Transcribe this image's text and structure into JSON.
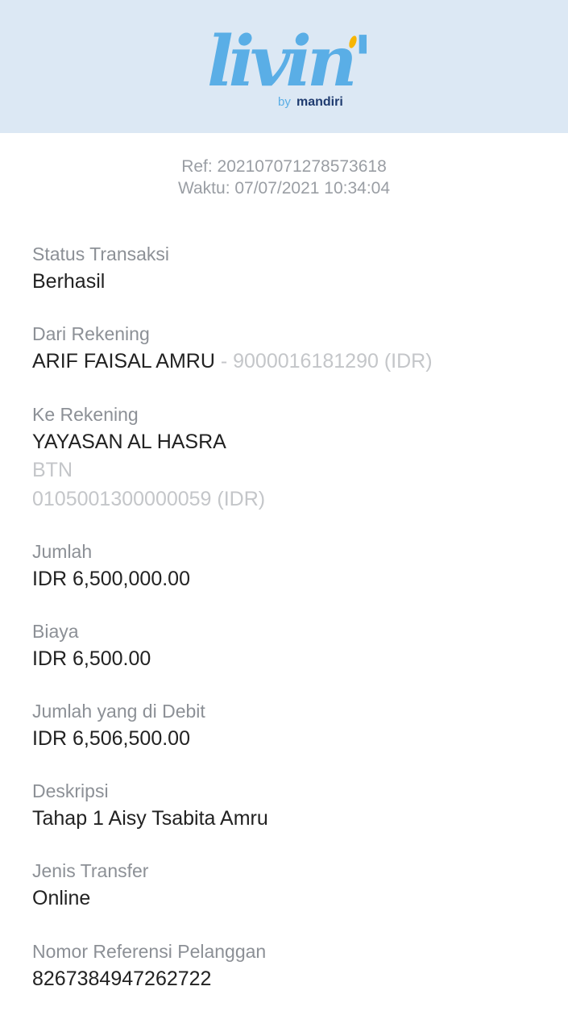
{
  "brand": {
    "logo_text": "livin'",
    "by_text": "by",
    "bank_text": "mandiri",
    "accent_color": "#5aaee6",
    "dot_color": "#f7b500"
  },
  "receipt": {
    "ref": "Ref: 202107071278573618",
    "time": "Waktu: 07/07/2021 10:34:04"
  },
  "fields": {
    "status": {
      "label": "Status Transaksi",
      "value": "Berhasil"
    },
    "from": {
      "label": "Dari Rekening",
      "name": "ARIF FAISAL AMRU",
      "account": " - 9000016181290 (IDR)"
    },
    "to": {
      "label": "Ke Rekening",
      "name": "YAYASAN AL HASRA",
      "bank": "BTN",
      "account": "0105001300000059 (IDR)"
    },
    "amount": {
      "label": "Jumlah",
      "value": "IDR 6,500,000.00"
    },
    "fee": {
      "label": "Biaya",
      "value": "IDR 6,500.00"
    },
    "debited": {
      "label": "Jumlah yang di Debit",
      "value": "IDR 6,506,500.00"
    },
    "description": {
      "label": "Deskripsi",
      "value": "Tahap 1 Aisy Tsabita Amru"
    },
    "transfer_type": {
      "label": "Jenis Transfer",
      "value": "Online"
    },
    "customer_ref": {
      "label": "Nomor Referensi Pelanggan",
      "value": "8267384947262722"
    }
  }
}
